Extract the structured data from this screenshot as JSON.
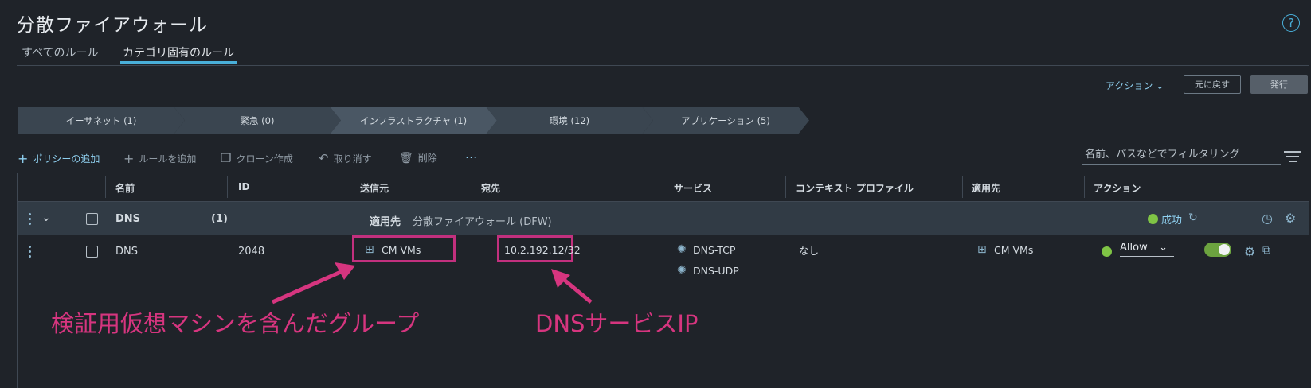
{
  "page": {
    "title": "分散ファイアウォール",
    "help_label": "?",
    "tabs": [
      "すべてのルール",
      "カテゴリ固有のルール"
    ]
  },
  "actions": {
    "menu_label": "アクション",
    "revert_label": "元に戻す",
    "publish_label": "発行"
  },
  "categories": [
    "イーサネット (1)",
    "緊急 (0)",
    "インフラストラクチャ (1)",
    "環境 (12)",
    "アプリケーション (5)"
  ],
  "toolbar": {
    "add_policy": "ポリシーの追加",
    "add_rule": "ルールを追加",
    "clone": "クローン作成",
    "undo": "取り消す",
    "delete": "削除",
    "more": "...",
    "filter_placeholder": "名前、パスなどでフィルタリング"
  },
  "columns": [
    "名前",
    "ID",
    "送信元",
    "宛先",
    "サービス",
    "コンテキスト プロファイル",
    "適用先",
    "アクション"
  ],
  "policy": {
    "name": "DNS",
    "count": "(1)",
    "applied_label": "適用先",
    "applied_value": "分散ファイアウォール (DFW)",
    "status": "成功"
  },
  "rule": {
    "name": "DNS",
    "id": "2048",
    "source": "CM VMs",
    "destination": "10.2.192.12/32",
    "services": [
      "DNS-TCP",
      "DNS-UDP"
    ],
    "context_profile": "なし",
    "applied_to": "CM VMs",
    "action": "Allow"
  },
  "annotations": {
    "group_label": "検証用仮想マシンを含んだグループ",
    "dns_label": "DNSサービスIP"
  },
  "colors": {
    "accent": "#49afd9",
    "highlight": "#c2307e",
    "success": "#7fc445"
  }
}
